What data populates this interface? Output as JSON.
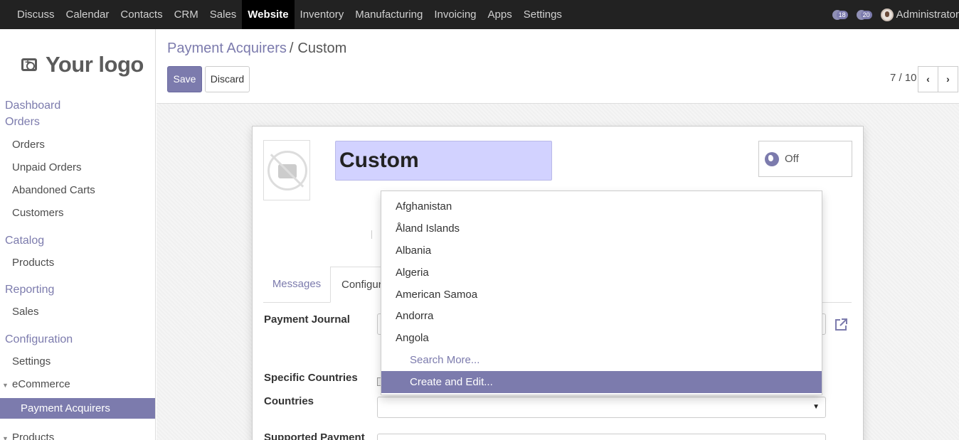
{
  "topbar": {
    "menu": [
      "Discuss",
      "Calendar",
      "Contacts",
      "CRM",
      "Sales",
      "Website",
      "Inventory",
      "Manufacturing",
      "Invoicing",
      "Apps",
      "Settings"
    ],
    "active_menu": "Website",
    "activity_count": "18",
    "messages_count": "20",
    "user_name": "Administrator"
  },
  "sidebar": {
    "logo_text": "Your logo",
    "sections": {
      "dashboard": "Dashboard",
      "orders_head": "Orders",
      "orders": "Orders",
      "unpaid_orders": "Unpaid Orders",
      "abandoned_carts": "Abandoned Carts",
      "customers": "Customers",
      "catalog_head": "Catalog",
      "products": "Products",
      "reporting_head": "Reporting",
      "sales": "Sales",
      "configuration_head": "Configuration",
      "settings": "Settings",
      "ecommerce": "eCommerce",
      "payment_acquirers": "Payment Acquirers",
      "products_sub": "Products"
    }
  },
  "breadcrumb": {
    "parent": "Payment Acquirers",
    "separator": "/",
    "current": "Custom"
  },
  "buttons": {
    "save": "Save",
    "discard": "Discard"
  },
  "pager": {
    "value": "7 / 10",
    "prev_icon": "chevron-left-icon",
    "next_icon": "chevron-right-icon"
  },
  "form": {
    "name": "Custom",
    "toggle_label": "Off",
    "tabs": {
      "messages": "Messages",
      "configuration": "Configuration"
    },
    "labels": {
      "payment_journal": "Payment Journal",
      "specific_countries": "Specific Countries",
      "countries": "Countries",
      "supported_payment": "Supported Payment"
    }
  },
  "dropdown": {
    "items": [
      "Afghanistan",
      "Åland Islands",
      "Albania",
      "Algeria",
      "American Samoa",
      "Andorra",
      "Angola"
    ],
    "search_more": "Search More...",
    "create_edit": "Create and Edit..."
  },
  "colors": {
    "accent": "#7c7bad",
    "topbar": "#222222",
    "name_field_bg": "#d2d2ff"
  }
}
